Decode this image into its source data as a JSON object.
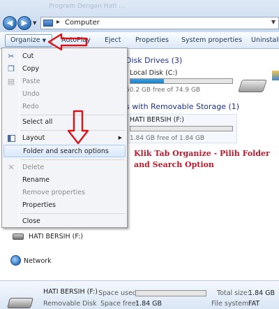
{
  "window": {
    "background_title": "Program Dengan Hati ...",
    "address": {
      "location": "Computer",
      "separator": "▸"
    }
  },
  "toolbar": {
    "organize": "Organize",
    "autoplay": "AutoPlay",
    "eject": "Eject",
    "properties": "Properties",
    "system_properties": "System properties",
    "uninstall": "Uninstall o"
  },
  "main": {
    "hard_disk_header": "Disk Drives (3)",
    "local_disk": {
      "label": "Local Disk (C:)",
      "free_text": "50.2 GB free of 74.9 GB",
      "used_fraction": 0.33
    },
    "removable_header": "s with Removable Storage (1)",
    "usb": {
      "label": "HATI BERSIH (F:)",
      "free_text": "1.84 GB free of 1.84 GB",
      "used_fraction": 0.0
    },
    "caption": "Klik Tab Organize - Pilih Folder and Search Option"
  },
  "nav": {
    "hati": "HATI BERSIH (F:)",
    "network": "Network"
  },
  "menu": {
    "cut": "Cut",
    "copy": "Copy",
    "paste": "Paste",
    "undo": "Undo",
    "redo": "Redo",
    "select_all": "Select all",
    "layout": "Layout",
    "folder_options": "Folder and search options",
    "delete": "Delete",
    "rename": "Rename",
    "remove_properties": "Remove properties",
    "properties": "Properties",
    "close": "Close"
  },
  "status": {
    "name": "HATI BERSIH (F:)",
    "type": "Removable Disk",
    "space_used_label": "Space used:",
    "space_free_label": "Space free:",
    "space_free_value": "1.84 GB",
    "total_size_label": "Total size:",
    "total_size_value": "1.84 GB",
    "file_system_label": "File system:",
    "file_system_value": "FAT",
    "used_fraction": 0.0
  },
  "colors": {
    "accent": "#1f7dc8",
    "annotation": "#d8141b",
    "header_text": "#1e3287"
  }
}
